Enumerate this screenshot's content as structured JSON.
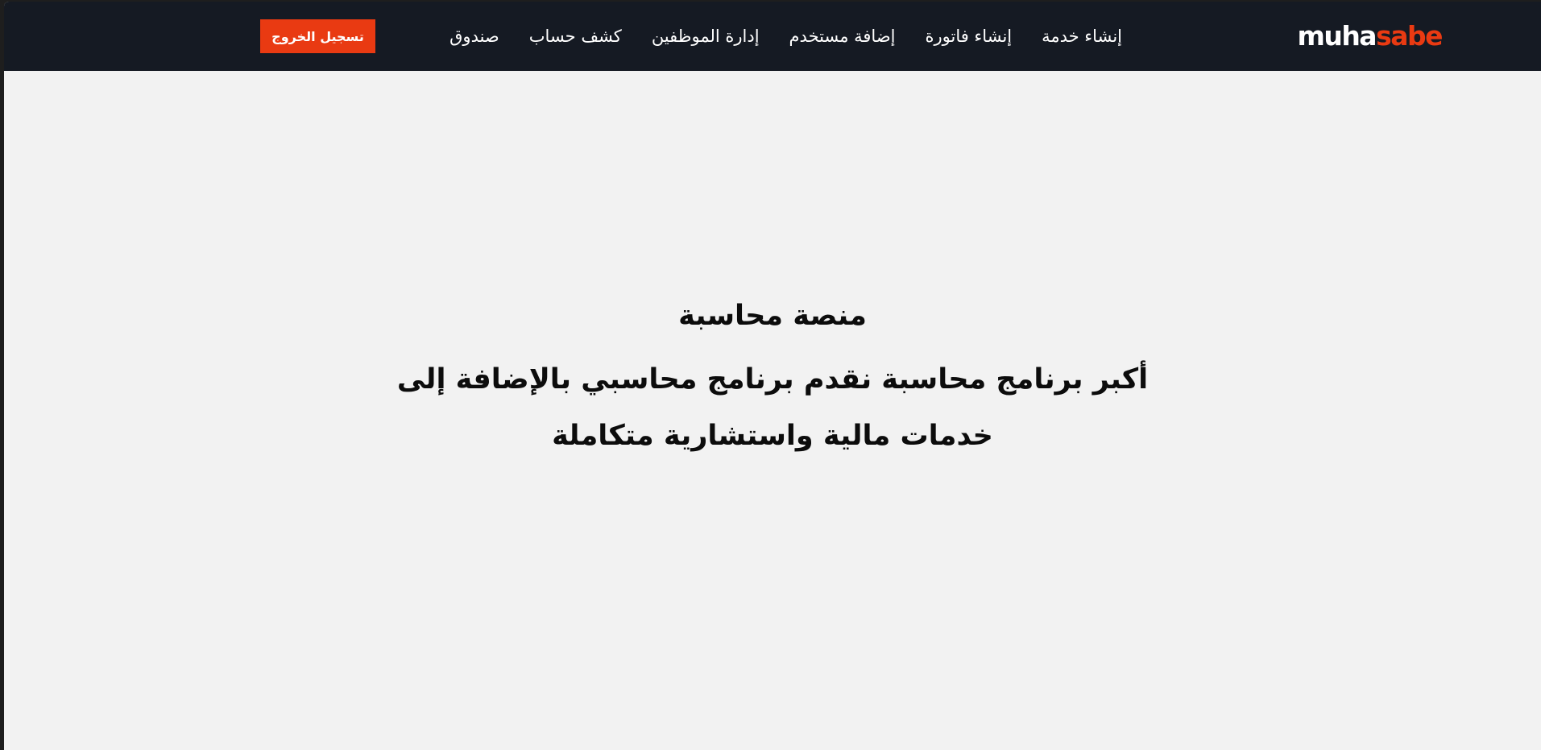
{
  "brand": {
    "name_part1": "muha",
    "name_part2": "sabe",
    "colors": {
      "accent": "#e93a12",
      "navbar_bg": "#151a23",
      "page_bg": "#f2f2f2"
    }
  },
  "nav": {
    "items": [
      {
        "label": "إنشاء خدمة"
      },
      {
        "label": "إنشاء فاتورة"
      },
      {
        "label": "إضافة مستخدم"
      },
      {
        "label": "إدارة الموظفين"
      },
      {
        "label": "كشف حساب"
      },
      {
        "label": "صندوق"
      }
    ],
    "logout_label": "تسجيل الخروج"
  },
  "hero": {
    "title": "منصة محاسبة",
    "subtitle": "أكبر برنامج محاسبة نقدم برنامج محاسبي بالإضافة إلى خدمات مالية واستشارية متكاملة"
  }
}
